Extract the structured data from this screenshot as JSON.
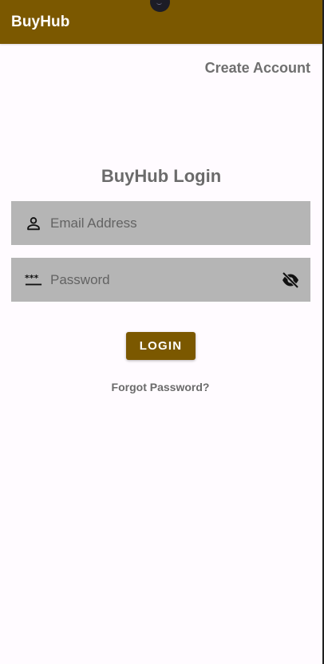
{
  "app_bar": {
    "title": "BuyHub"
  },
  "header": {
    "create_account_label": "Create Account"
  },
  "login": {
    "title": "BuyHub Login",
    "email_placeholder": "Email Address",
    "password_placeholder": "Password",
    "login_label": "LOGIN",
    "forgot_label": "Forgot Password?"
  },
  "icons": {
    "email": "person-icon",
    "password": "password-dots-icon",
    "toggle": "eye-off-icon"
  },
  "colors": {
    "brand": "#7b5800",
    "field_bg": "#b5b5b5",
    "background": "#fffbff",
    "muted_text": "#6b6b6b"
  }
}
